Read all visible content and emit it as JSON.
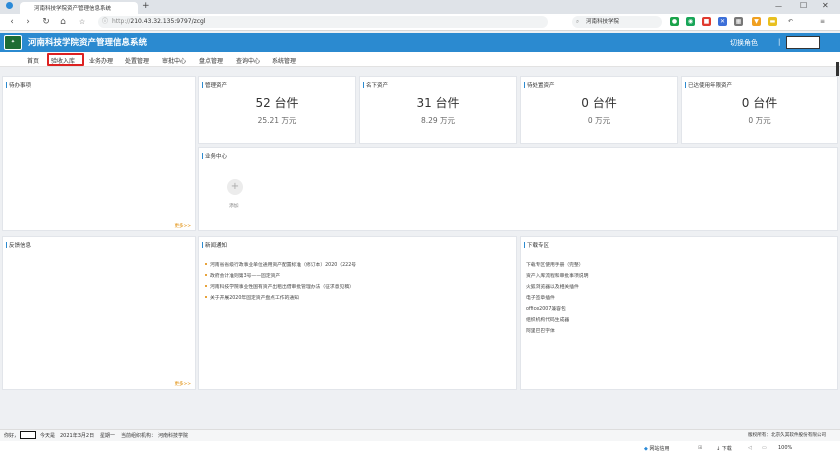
{
  "browser": {
    "tab_title": "河南科技学院资产管理信息系统",
    "url_prefix": "http://",
    "url": "210.43.32.135:9797/zcgl",
    "search_text": "河南科技学院",
    "new_tab": "+",
    "status_items": [
      "网站信用",
      "下载",
      "100%"
    ]
  },
  "app": {
    "title": "河南科技学院资产管理信息系统",
    "switch_role": "切换角色",
    "separator": "|"
  },
  "menu": [
    "首页",
    "验收入库",
    "业务办理",
    "处置管理",
    "审批中心",
    "盘点管理",
    "查询中心",
    "系统管理"
  ],
  "panels": {
    "todo": {
      "title": "待办事项",
      "more": "更多>>"
    },
    "managed": {
      "title": "管理资产",
      "count": "52 台件",
      "amount": "25.21 万元"
    },
    "inside": {
      "title": "名下资产",
      "count": "31 台件",
      "amount": "8.29 万元"
    },
    "pending": {
      "title": "待处置资产",
      "count": "0 台件",
      "amount": "0 万元"
    },
    "overdue": {
      "title": "已达使用年限资产",
      "count": "0 台件",
      "amount": "0 万元"
    },
    "business": {
      "title": "业务中心",
      "add_label": "添加"
    },
    "feedback": {
      "title": "反馈信息",
      "more": "更多>>"
    },
    "news": {
      "title": "新闻通知",
      "items": [
        "河南省省级行政事业单位通用资产配置标准（修订本）2020（222号",
        "政府会计准则第3号——固定资产",
        "河南科技学院事业性国有资产出租出借审批管理办法（征求意见稿）",
        "关于开展2020年固定资产盘点工作的通知"
      ]
    },
    "download": {
      "title": "下载专区",
      "items": [
        "下载专区使用手册（完整）",
        "资产入库流程和审批事项说明",
        "火狐浏览器以及相关插件",
        "电子签章插件",
        "office2007兼容包",
        "组织机构代码生成器",
        "阿里巴巴字体"
      ]
    }
  },
  "footer": {
    "user_label": "你好，",
    "today_label": "今天是",
    "date": "2021年3月2日",
    "weekday": "星期一",
    "org_label": "当前组织机构：",
    "org": "河南科技学院",
    "copyright": "版权所有：北京久其软件股份有限公司"
  },
  "colors": {
    "brand": "#2b8ad0",
    "highlight": "#dd2222",
    "bullet": "#e8a33a"
  }
}
